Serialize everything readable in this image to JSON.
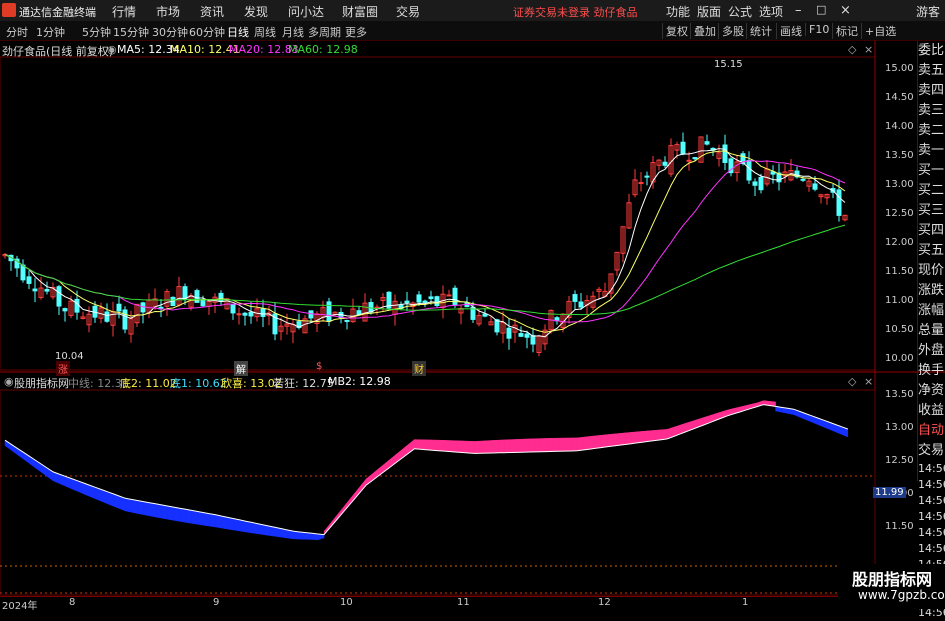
{
  "app": {
    "brand": "通达信金融终端",
    "menus": [
      "行情",
      "市场",
      "资讯",
      "发现",
      "问小达",
      "财富圈",
      "交易"
    ],
    "notice": "证券交易未登录  劲仔食品",
    "right_menus": [
      "功能",
      "版面",
      "公式",
      "选项"
    ],
    "guest": "游客"
  },
  "toolbar": {
    "periods": [
      "分时",
      "1分钟",
      "5分钟",
      "15分钟",
      "30分钟",
      "60分钟",
      "日线",
      "周线",
      "月线",
      "多周期",
      "更多"
    ],
    "selected": "日线",
    "buttons": [
      "复权",
      "叠加",
      "多股",
      "统计",
      "画线",
      "F10",
      "标记",
      "+自选"
    ]
  },
  "main": {
    "title": "劲仔食品(日线 前复权)",
    "ma": [
      {
        "label": "MA5: 12.34",
        "color": "#ffffff"
      },
      {
        "label": "MA10: 12.41",
        "color": "#ffff66"
      },
      {
        "label": "MA20: 12.83",
        "color": "#ff33ff"
      },
      {
        "label": "MA60: 12.98",
        "color": "#33dd33"
      }
    ],
    "high_label": "15.15",
    "low_label": "10.04",
    "y_ticks": [
      "15.00",
      "14.50",
      "14.00",
      "13.50",
      "13.00",
      "12.50",
      "12.00",
      "11.50",
      "11.00",
      "10.50",
      "10.00"
    ],
    "events": [
      "涨",
      "解",
      "$",
      "财"
    ]
  },
  "indicator": {
    "name": "股朋指标网",
    "values": [
      {
        "label": "中线: 12.31",
        "color": "#888888"
      },
      {
        "label": "底2: 11.02",
        "color": "#ffee44"
      },
      {
        "label": "底1: 10.62",
        "color": "#44ddff"
      },
      {
        "label": "欣喜: 13.02",
        "color": "#ffee44"
      },
      {
        "label": "若狂: 12.75",
        "color": "#dddddd"
      },
      {
        "label": "MB2: 12.98",
        "color": "#ffffff"
      }
    ],
    "y_ticks": [
      "13.50",
      "13.00",
      "12.50",
      "12.00",
      "11.50"
    ],
    "marker": "11.99"
  },
  "right_panel": {
    "items": [
      "委比",
      "卖五",
      "卖四",
      "卖三",
      "卖二",
      "卖一",
      "买一",
      "买二",
      "买三",
      "买四",
      "买五",
      "现价",
      "涨跌",
      "涨幅",
      "总量",
      "外盘",
      "换手",
      "净资",
      "收益"
    ],
    "auto": "自动",
    "trade": "交易",
    "time_vals": [
      "14:56",
      "14:56",
      "14:56",
      "14:56",
      "14:56",
      "14:56",
      "14:56",
      "14:56",
      "14:56",
      "14:56"
    ]
  },
  "dates": [
    "2024年",
    "8",
    "9",
    "10",
    "11",
    "12",
    "1"
  ],
  "watermark": {
    "line1": "股朋指标网",
    "line2": "www.7gpzb.com"
  },
  "colors": {
    "up": "#ff3d3d",
    "down": "#54ffff",
    "ma5": "#ffffff",
    "ma10": "#ffff66",
    "ma20": "#ff33ff",
    "ma60": "#33dd33",
    "ribbon_up": "#ff2d8f",
    "ribbon_down": "#1530ff"
  }
}
